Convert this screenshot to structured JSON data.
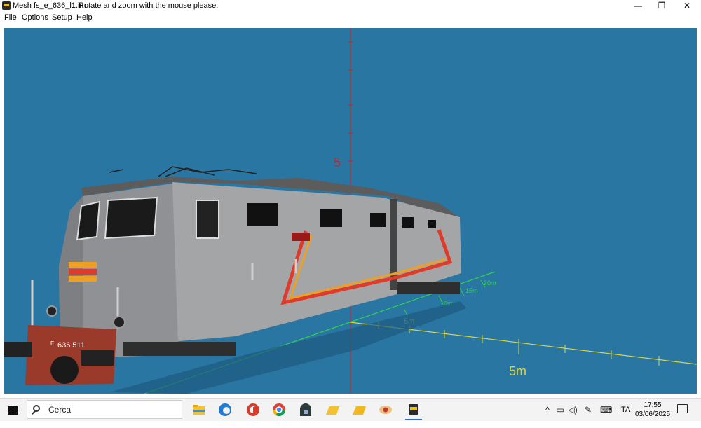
{
  "window": {
    "title": "Mesh fs_e_636_l1.im",
    "hint": "Rotate and zoom with the mouse please.",
    "minimize_glyph": "—",
    "restore_glyph": "❐",
    "close_glyph": "✕"
  },
  "menu": {
    "items": [
      {
        "label": "File"
      },
      {
        "label": "Options"
      },
      {
        "label": "Setup"
      },
      {
        "label": "Help"
      }
    ]
  },
  "viewport": {
    "background": "#2a76a3",
    "axis_y_label": "5",
    "axis_x_label": "5m",
    "green_axis_labels": [
      "5m",
      "10m",
      "15m",
      "20m"
    ],
    "locomotive": {
      "number_plate": "636 511",
      "plate_prefix": "E",
      "body_color": "#9ea0a2",
      "roof_color": "#5c5c5c",
      "stripe_colors": [
        "#e03a2a",
        "#f0a020"
      ]
    }
  },
  "taskbar": {
    "search_placeholder": "Cerca",
    "apps": [
      {
        "name": "file-explorer-icon"
      },
      {
        "name": "edge-icon"
      },
      {
        "name": "ccleaner-icon"
      },
      {
        "name": "chrome-icon"
      },
      {
        "name": "app-dark-icon"
      },
      {
        "name": "folder-yellow-icon"
      },
      {
        "name": "folder-yellow-2-icon"
      },
      {
        "name": "eye-app-icon"
      },
      {
        "name": "train-app-icon"
      }
    ],
    "tray": {
      "language": "ITA",
      "time": "17:55",
      "date": "03/06/2025"
    }
  }
}
